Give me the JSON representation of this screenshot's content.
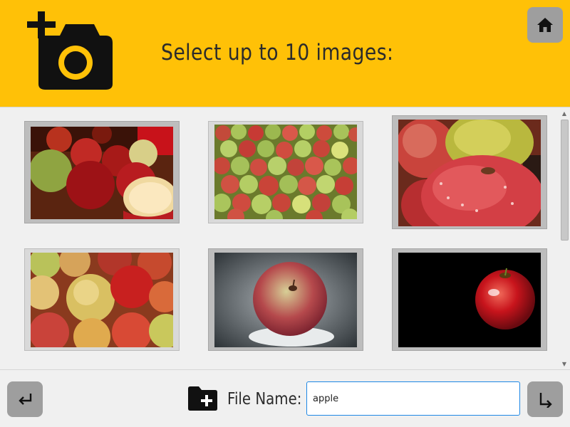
{
  "header": {
    "title": "Select up to 10 images:",
    "background_color": "#ffc107",
    "icon": "add-photo-camera-icon",
    "home_icon": "home-icon"
  },
  "gallery": {
    "images": [
      {
        "subject": "apple",
        "description": "Red and green apples with a cut apple half"
      },
      {
        "subject": "apple",
        "description": "Pile of green and red apples"
      },
      {
        "subject": "apple",
        "description": "Close-up of red apple with water droplets"
      },
      {
        "subject": "apple",
        "description": "Heap of red and yellow apples"
      },
      {
        "subject": "apple",
        "description": "Single red apple on gray background"
      },
      {
        "subject": "apple",
        "description": "Single red apple on black background"
      }
    ]
  },
  "footer": {
    "back_icon": "return-left-icon",
    "folder_icon": "add-folder-icon",
    "file_label": "File Name:",
    "file_value": "apple",
    "next_icon": "return-right-icon",
    "input_border_color": "#1e88e5"
  }
}
